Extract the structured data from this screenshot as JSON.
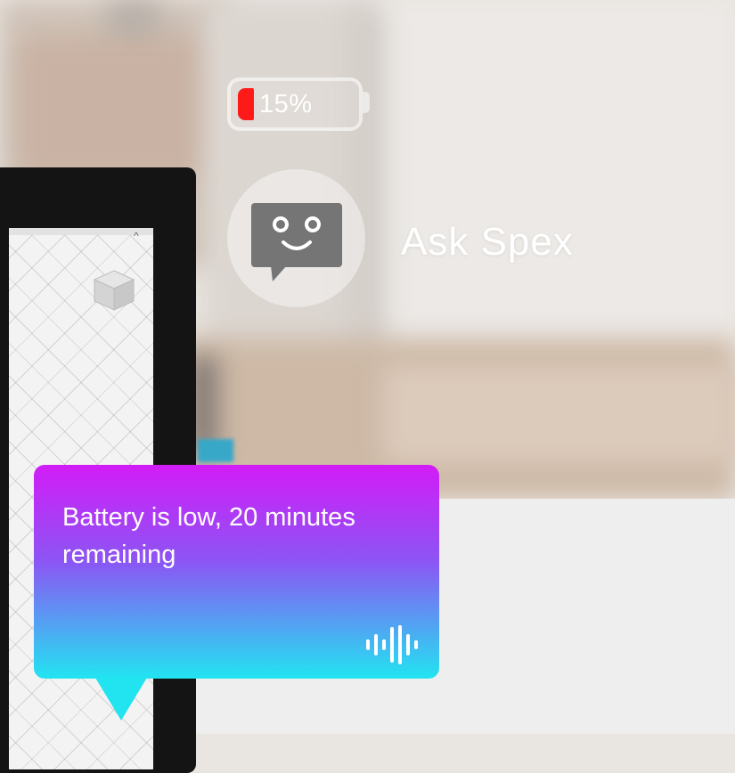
{
  "battery": {
    "percent_label": "15%",
    "level": 0.15,
    "fill_color": "#ff1a1a"
  },
  "assistant": {
    "label": "Ask Spex",
    "icon": "chat-bot-face-icon"
  },
  "notification": {
    "message": "Battery is low, 20 minutes remaining",
    "icon": "voice-waveform-icon",
    "gradient": [
      "#d21cf7",
      "#8c55f4",
      "#22e4f1"
    ]
  }
}
